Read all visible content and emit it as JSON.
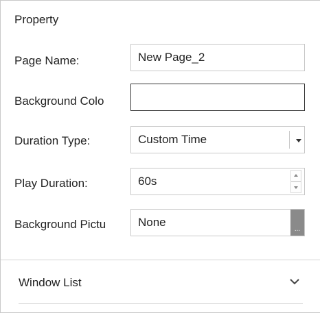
{
  "panel": {
    "title": "Property"
  },
  "fields": {
    "page_name": {
      "label": "Page Name:",
      "value": "New Page_2"
    },
    "background_color": {
      "label": "Background Colo",
      "value": ""
    },
    "duration_type": {
      "label": "Duration Type:",
      "value": "Custom Time"
    },
    "play_duration": {
      "label": "Play Duration:",
      "value": "60s"
    },
    "background_picture": {
      "label": "Background Pictu",
      "value": "None",
      "browse_label": "..."
    }
  },
  "sections": {
    "window_list": {
      "label": "Window List",
      "icon": "chevron-down-icon"
    }
  },
  "colors": {
    "border": "#c7c7c7",
    "browse_button": "#8a8a8a",
    "divider": "#d4d4d4"
  }
}
